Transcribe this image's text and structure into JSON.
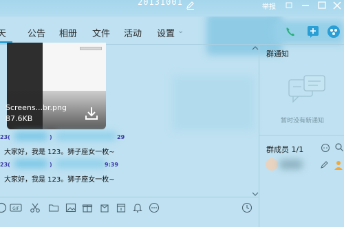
{
  "window": {
    "title": "20131001",
    "report_label": "举报"
  },
  "tabs": [
    {
      "label": "聊天"
    },
    {
      "label": "公告"
    },
    {
      "label": "相册"
    },
    {
      "label": "文件"
    },
    {
      "label": "活动"
    },
    {
      "label": "设置"
    }
  ],
  "tabs_visible": {
    "chat": "天",
    "settings_suffix": "⌄"
  },
  "file_message": {
    "name": "Screens...br.png",
    "size": "87.6KB"
  },
  "messages": [
    {
      "meta_left": "23(",
      "meta_right": "29",
      "text": "大家好，我是 123。狮子座女一枚~"
    },
    {
      "meta_left": "23(",
      "meta_right": "9:39",
      "text": "大家好，我是 123。狮子座女一枚~"
    }
  ],
  "right_panel": {
    "notice_title": "群通知",
    "notice_empty": "暂时没有新通知",
    "members_title": "群成员 1/1"
  },
  "icons": {
    "toolbar": [
      "emoji-icon",
      "gif-icon",
      "scissors-icon",
      "folder-icon",
      "image-icon",
      "gift-icon",
      "red-packet-icon",
      "calendar-icon",
      "bell-icon",
      "more-icon",
      "history-icon"
    ]
  },
  "colors": {
    "background": "#bfe1f1",
    "accent": "#2a9fd6",
    "meta_text": "#3a3aa8"
  }
}
